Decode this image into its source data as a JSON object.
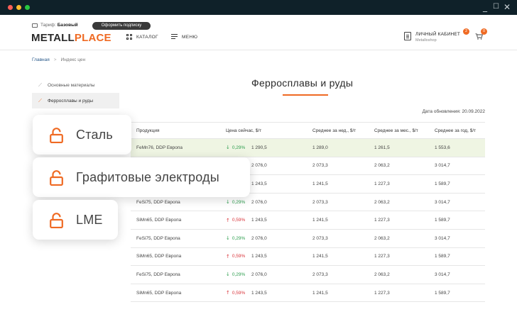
{
  "window": {
    "controls": [
      "_",
      "☐",
      "✕"
    ]
  },
  "header": {
    "tariff_label": "Тариф:",
    "tariff_value": "Базовый",
    "subscribe_label": "Оформить подписку",
    "logo_part1": "METALL",
    "logo_part2": "PLACE",
    "catalog_label": "КАТАЛОГ",
    "menu_label": "МЕНЮ",
    "cabinet_title": "ЛИЧНЫЙ КАБИНЕТ",
    "cabinet_sub": "Metalloshop",
    "cabinet_badge": "2",
    "cart_badge": "0"
  },
  "breadcrumb": {
    "home": "Главная",
    "separator": ">",
    "current": "Индекс цен"
  },
  "sidebar": {
    "items": [
      {
        "label": "Основные материалы",
        "icon": "trend-icon",
        "active": false
      },
      {
        "label": "Ферросплавы и руды",
        "icon": "trend-icon",
        "active": true
      }
    ]
  },
  "main": {
    "title": "Ферросплавы и руды",
    "updated": "Дата обновления: 20.09.2022"
  },
  "table": {
    "headers": [
      "Продукция",
      "Цена сейчас, $/т",
      "Среднее за нед., $/т",
      "Среднее за мес., $/т",
      "Среднее за год, $/т"
    ],
    "rows": [
      {
        "product": "FeMn76, DDP Европа",
        "dir": "down",
        "change": "0,29%",
        "price": "1 290,5",
        "week": "1 289,0",
        "month": "1 261,5",
        "year": "1 553,6"
      },
      {
        "product": "",
        "dir": "",
        "change": "",
        "price": "2 076,0",
        "week": "2 073,3",
        "month": "2 063,2",
        "year": "3 014,7"
      },
      {
        "product": "",
        "dir": "",
        "change": "",
        "price": "1 243,5",
        "week": "1 241,5",
        "month": "1 227,3",
        "year": "1 589,7"
      },
      {
        "product": "FeSi75, DDP Европа",
        "dir": "down",
        "change": "0,29%",
        "price": "2 076,0",
        "week": "2 073,3",
        "month": "2 063,2",
        "year": "3 014,7"
      },
      {
        "product": "SiMn65, DDP Европа",
        "dir": "up",
        "change": "0,59%",
        "price": "1 243,5",
        "week": "1 241,5",
        "month": "1 227,3",
        "year": "1 589,7"
      },
      {
        "product": "FeSi75, DDP Европа",
        "dir": "down",
        "change": "0,29%",
        "price": "2 076,0",
        "week": "2 073,3",
        "month": "2 063,2",
        "year": "3 014,7"
      },
      {
        "product": "SiMn65, DDP Европа",
        "dir": "up",
        "change": "0,59%",
        "price": "1 243,5",
        "week": "1 241,5",
        "month": "1 227,3",
        "year": "1 589,7"
      },
      {
        "product": "FeSi75, DDP Европа",
        "dir": "down",
        "change": "0,29%",
        "price": "2 076,0",
        "week": "2 073,3",
        "month": "2 063,2",
        "year": "3 014,7"
      },
      {
        "product": "SiMn65, DDP Европа",
        "dir": "up",
        "change": "0,59%",
        "price": "1 243,5",
        "week": "1 241,5",
        "month": "1 227,3",
        "year": "1 589,7"
      }
    ]
  },
  "locked_cards": [
    {
      "label": "Сталь",
      "icon": "lock-open-icon"
    },
    {
      "label": "Графитовые электроды",
      "icon": "lock-open-icon"
    },
    {
      "label": "LME",
      "icon": "lock-open-icon"
    }
  ],
  "colors": {
    "accent": "#ef6a23",
    "down": "#2e9e4f",
    "up": "#d9343a",
    "highlight_row": "#eff5e3",
    "titlebar": "#0f2129"
  }
}
